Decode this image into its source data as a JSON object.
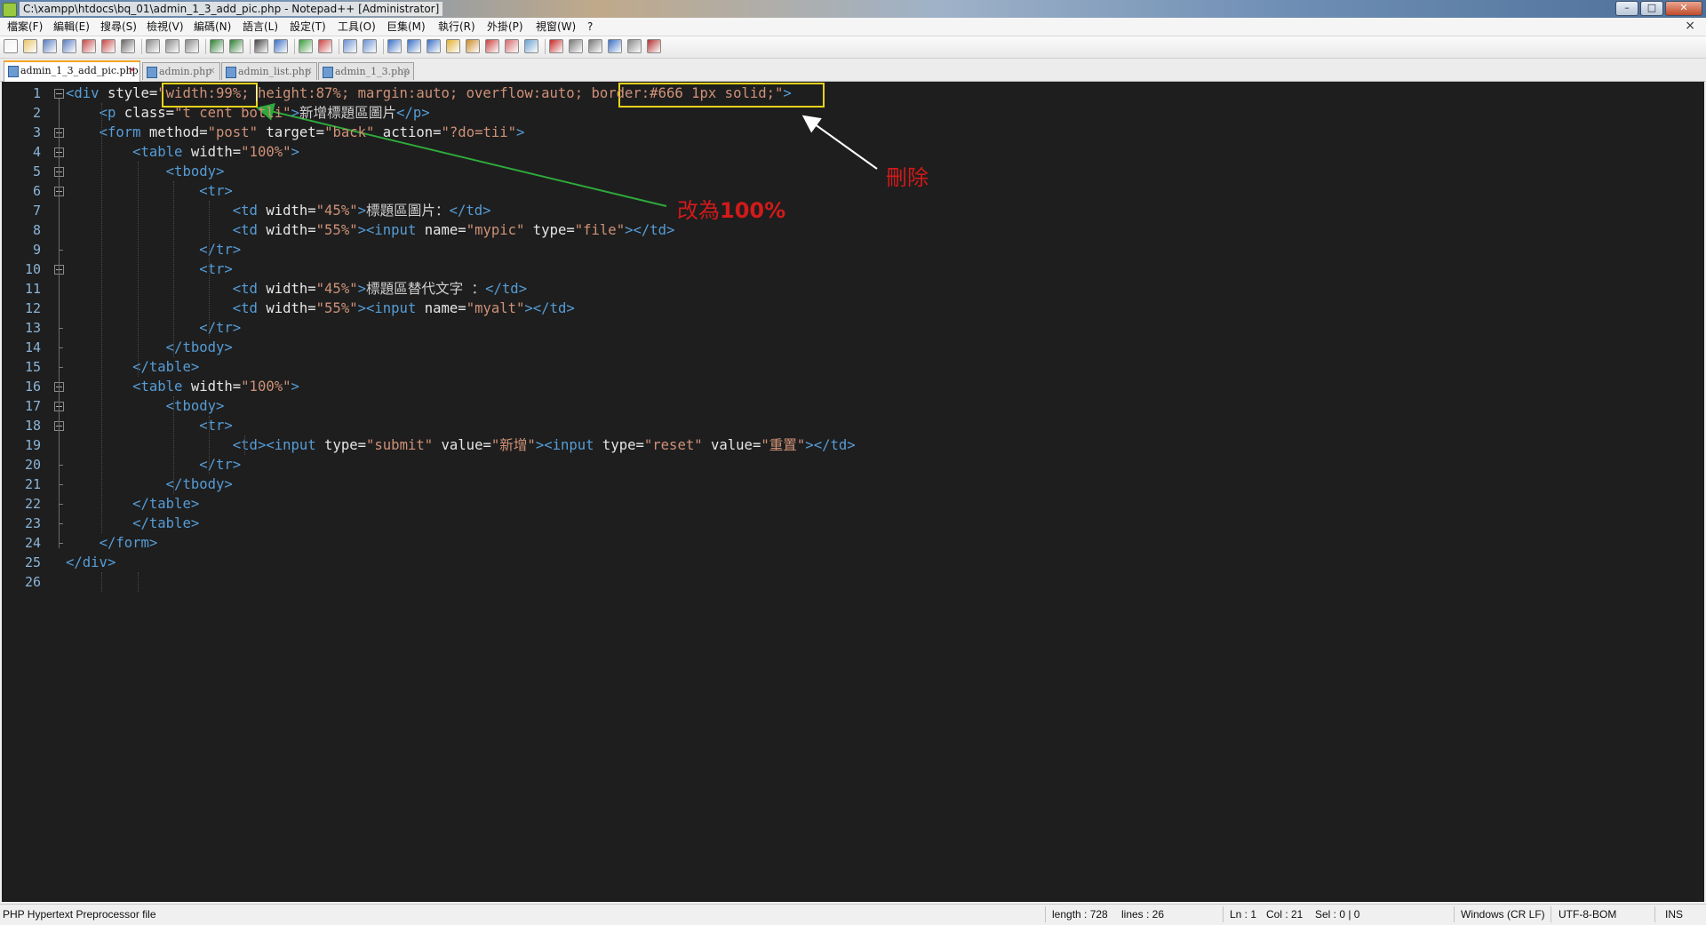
{
  "window": {
    "title": "C:\\xampp\\htdocs\\bq_01\\admin_1_3_add_pic.php - Notepad++ [Administrator]",
    "buttons": [
      "–",
      "□",
      "✕"
    ]
  },
  "menu": {
    "items": [
      "檔案(F)",
      "編輯(E)",
      "搜尋(S)",
      "檢視(V)",
      "編碼(N)",
      "語言(L)",
      "設定(T)",
      "工具(O)",
      "巨集(M)",
      "執行(R)",
      "外掛(P)",
      "視窗(W)",
      "?"
    ],
    "close_label": "×"
  },
  "tabs": [
    {
      "label": "admin_1_3_add_pic.php",
      "active": true
    },
    {
      "label": "admin.php",
      "active": false
    },
    {
      "label": "admin_list.php",
      "active": false
    },
    {
      "label": "admin_1_3.php",
      "active": false
    }
  ],
  "editor": {
    "line_numbers": [
      "1",
      "2",
      "3",
      "4",
      "5",
      "6",
      "7",
      "8",
      "9",
      "10",
      "11",
      "12",
      "13",
      "14",
      "15",
      "16",
      "17",
      "18",
      "19",
      "20",
      "21",
      "22",
      "23",
      "24",
      "25",
      "26"
    ],
    "lines": [
      "<div style=\"width:99%; height:87%; margin:auto; overflow:auto; border:#666 1px solid;\">",
      "    <p class=\"t cent botli\">新增標題區圖片</p>",
      "    <form method=\"post\" target=\"back\" action=\"?do=tii\">",
      "        <table width=\"100%\">",
      "            <tbody>",
      "                <tr>",
      "                    <td width=\"45%\">標題區圖片：</td>",
      "                    <td width=\"55%\"><input name=\"mypic\" type=\"file\"></td>",
      "                </tr>",
      "                <tr>",
      "                    <td width=\"45%\">標題區替代文字 ：</td>",
      "                    <td width=\"55%\"><input name=\"myalt\"></td>",
      "                </tr>",
      "            </tbody>",
      "        </table>",
      "        <table width=\"100%\">",
      "            <tbody>",
      "                <tr>",
      "                    <td><input type=\"submit\" value=\"新增\"><input type=\"reset\" value=\"重置\"></td>",
      "                </tr>",
      "            </tbody>",
      "        </table>",
      "        </table>",
      "    </form>",
      "</div>",
      ""
    ]
  },
  "annotations": {
    "delete_label": "刪除",
    "change_prefix": "改為",
    "change_value": "100%",
    "color": "#d11a1a",
    "highlight_color": "#e8d21a",
    "green_arrow_color": "#2eaa3c",
    "white_arrow_color": "#ffffff"
  },
  "status": {
    "file_type": "PHP Hypertext Preprocessor file",
    "length": "length : 728",
    "lines": "lines : 26",
    "ln": "Ln : 1",
    "col": "Col : 21",
    "sel": "Sel : 0 | 0",
    "eol": "Windows (CR LF)",
    "encoding": "UTF-8-BOM",
    "mode": "INS"
  },
  "colors": {
    "editor_bg": "#1e1e1e",
    "tag": "#569cd6",
    "string": "#ce9178",
    "line_number": "#8ab4d8"
  },
  "toolbar_icons": [
    "new-file-icon",
    "open-file-icon",
    "save-icon",
    "save-all-icon",
    "close-icon",
    "close-all-icon",
    "print-icon",
    "cut-icon",
    "copy-icon",
    "paste-icon",
    "undo-icon",
    "redo-icon",
    "find-icon",
    "replace-icon",
    "zoom-in-icon",
    "zoom-out-icon",
    "sync-v-icon",
    "sync-h-icon",
    "word-wrap-icon",
    "show-all-chars-icon",
    "indent-guide-icon",
    "udl-icon",
    "doc-map-icon",
    "function-list-icon",
    "folder-as-workspace-icon",
    "monitor-icon",
    "record-macro-icon",
    "stop-macro-icon",
    "play-macro-icon",
    "run-macro-multiple-icon",
    "save-macro-icon",
    "spellcheck-icon"
  ]
}
